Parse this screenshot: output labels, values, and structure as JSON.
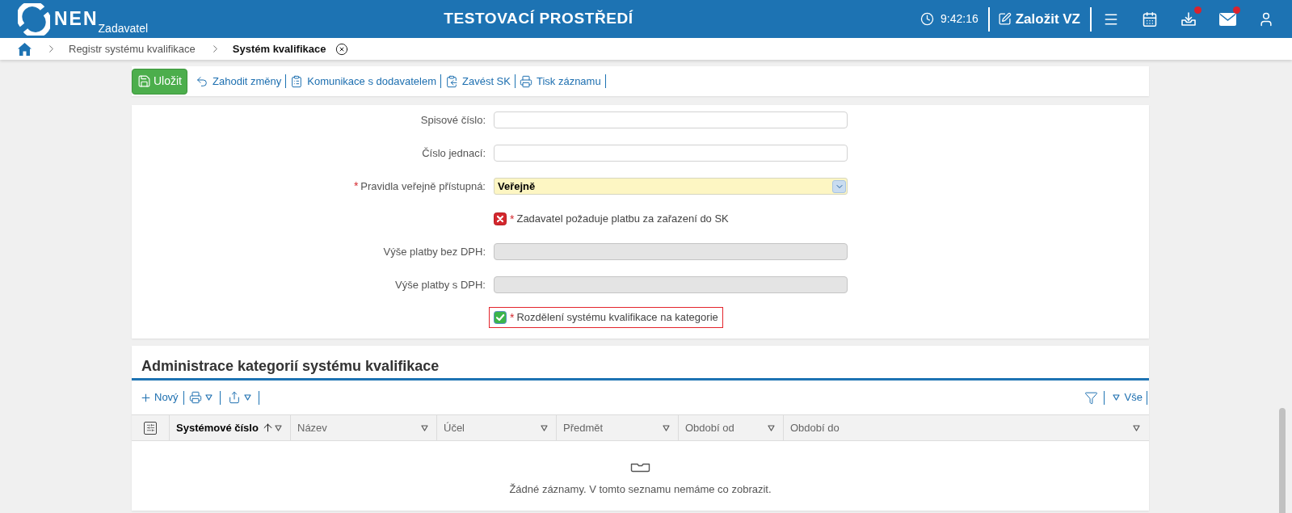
{
  "header": {
    "logo_text": "NEN",
    "logo_subtitle": "Zadavatel",
    "environment": "TESTOVACÍ PROSTŘEDÍ",
    "time": "9:42:16",
    "create_button": "Založit VZ",
    "icons": [
      {
        "kind": "menu",
        "badge": false
      },
      {
        "kind": "calendar",
        "badge": false
      },
      {
        "kind": "download",
        "badge": true
      },
      {
        "kind": "mail",
        "badge": true
      },
      {
        "kind": "user",
        "badge": false
      }
    ]
  },
  "breadcrumb": [
    {
      "label": "Registr systému kvalifikace",
      "current": false
    },
    {
      "label": "Systém kvalifikace",
      "current": true
    }
  ],
  "toolbar": [
    {
      "kind": "save",
      "label": "Uložit"
    },
    {
      "kind": "discard",
      "label": "Zahodit změny"
    },
    {
      "kind": "communication",
      "label": "Komunikace s dodavatelem"
    },
    {
      "kind": "establish",
      "label": "Zavést SK"
    },
    {
      "kind": "print",
      "label": "Tisk záznamu"
    }
  ],
  "form": {
    "required_mark": "*",
    "fields": [
      {
        "kind": "text",
        "label": "Spisové číslo:",
        "required": false,
        "disabled": false
      },
      {
        "kind": "text",
        "label": "Číslo jednací:",
        "required": false,
        "disabled": false
      },
      {
        "kind": "select",
        "label": "Pravidla veřejně přístupná:",
        "required": true,
        "value": "Veřejně"
      },
      {
        "kind": "checkbox",
        "label": "Zadavatel požaduje platbu za zařazení do SK",
        "required": true,
        "checked": false,
        "focused": false
      },
      {
        "kind": "text",
        "label": "Výše platby bez DPH:",
        "required": false,
        "disabled": true
      },
      {
        "kind": "text",
        "label": "Výše platby s DPH:",
        "required": false,
        "disabled": true
      },
      {
        "kind": "checkbox",
        "label": "Rozdělení systému kvalifikace na kategorie",
        "required": true,
        "checked": true,
        "focused": true
      }
    ]
  },
  "table": {
    "title": "Administrace kategorií systému kvalifikace",
    "new_label": "Nový",
    "filter_label": "Vše",
    "columns": [
      {
        "label": "Systémové číslo",
        "sorted": true
      },
      {
        "label": "Název",
        "sorted": false
      },
      {
        "label": "Účel",
        "sorted": false
      },
      {
        "label": "Předmět",
        "sorted": false
      },
      {
        "label": "Období od",
        "sorted": false
      },
      {
        "label": "Období do",
        "sorted": false
      }
    ],
    "empty_message": "Žádné záznamy. V tomto seznamu nemáme co zobrazit."
  }
}
